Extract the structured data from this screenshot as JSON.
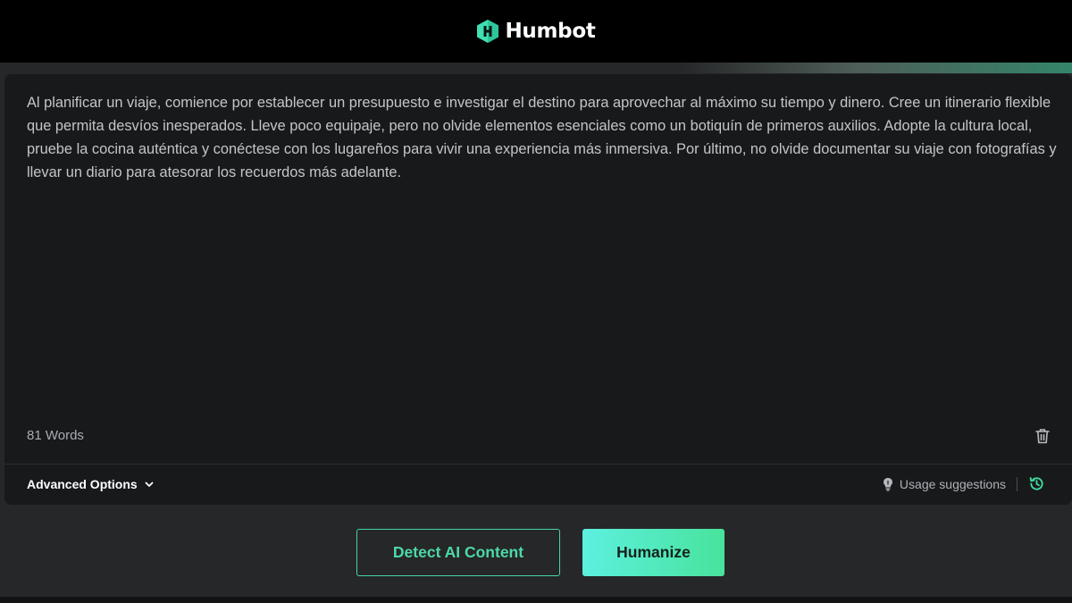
{
  "header": {
    "brand_name": "Humbot",
    "logo_icon": "humbot-hexagon-logo-icon",
    "accent_color": "#4fe3b0"
  },
  "editor": {
    "text": "Al planificar un viaje, comience por establecer un presupuesto e investigar el destino para aprovechar al máximo su tiempo y dinero. Cree un itinerario flexible que permita desvíos inesperados. Lleve poco equipaje, pero no olvide elementos esenciales como un botiquín de primeros auxilios. Adopte la cultura local, pruebe la cocina auténtica y conéctese con los lugareños para vivir una experiencia más inmersiva. Por último, no olvide documentar su viaje con fotografías y llevar un diario para atesorar los recuerdos más adelante.",
    "word_count": "81 Words",
    "delete_icon": "trash-icon"
  },
  "options_bar": {
    "advanced_options_label": "Advanced Options",
    "advanced_options_icon": "chevron-down-icon",
    "usage_suggestions_label": "Usage suggestions",
    "usage_suggestions_icon": "lightbulb-icon",
    "history_icon": "history-icon"
  },
  "actions": {
    "detect_label": "Detect AI Content",
    "humanize_label": "Humanize",
    "colors": {
      "detect_border": "#45d6a3",
      "humanize_gradient_start": "#5cf0df",
      "humanize_gradient_end": "#48e39c"
    }
  }
}
